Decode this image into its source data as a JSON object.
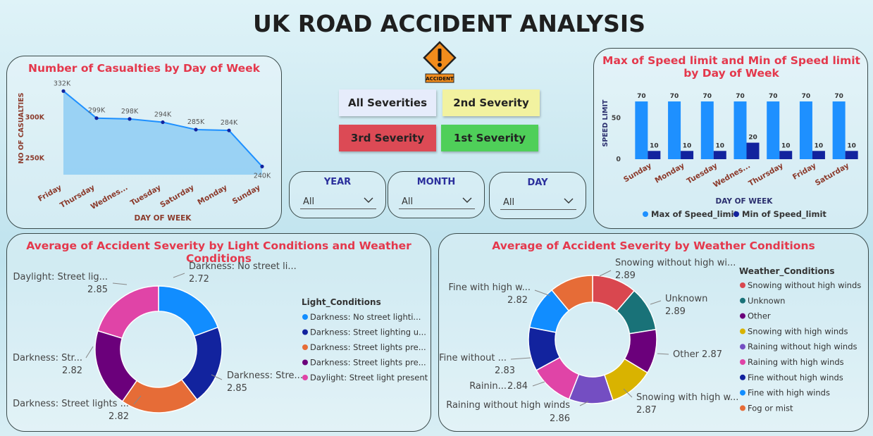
{
  "title": "UK ROAD ACCIDENT ANALYSIS",
  "logo_label": "ACCIDENT",
  "buttons": {
    "all": "All Severities",
    "second": "2nd Severity",
    "third": "3rd Severity",
    "first": "1st Severity"
  },
  "colors": {
    "title_red": "#e4384c",
    "btn_all": "#e6ecfb",
    "btn_second": "#f2f2a0",
    "btn_third": "#dc4a55",
    "btn_first": "#4fcf59",
    "line_fill": "#8ecdf3",
    "line_stroke": "#1e90ff",
    "bar_max": "#1e90ff",
    "bar_min": "#12239e"
  },
  "slicers": [
    {
      "label": "YEAR",
      "value": "All"
    },
    {
      "label": "MONTH",
      "value": "All"
    },
    {
      "label": "DAY",
      "value": "All"
    }
  ],
  "chart_data": [
    {
      "id": "casualties",
      "type": "area",
      "title": "Number of Casualties by Day of Week",
      "xlabel": "DAY OF WEEK",
      "ylabel": "NO OF CASUALTIES",
      "categories": [
        "Friday",
        "Thursday",
        "Wednes...",
        "Tuesday",
        "Saturday",
        "Monday",
        "Sunday"
      ],
      "values": [
        332000,
        299000,
        298000,
        294000,
        285000,
        284000,
        240000
      ],
      "data_labels": [
        "332K",
        "299K",
        "298K",
        "294K",
        "285K",
        "284K",
        "240K"
      ],
      "yticks": [
        250000,
        300000
      ],
      "ytick_labels": [
        "250K",
        "300K"
      ],
      "ylim": [
        230000,
        340000
      ]
    },
    {
      "id": "speed",
      "type": "bar",
      "title": "Max of Speed limit and Min of Speed limit by Day of Week",
      "xlabel": "DAY OF WEEK",
      "ylabel": "SPEED LIMIT",
      "categories": [
        "Sunday",
        "Monday",
        "Tuesday",
        "Wednes...",
        "Thursday",
        "Friday",
        "Saturday"
      ],
      "series": [
        {
          "name": "Max of Speed_limit",
          "values": [
            70,
            70,
            70,
            70,
            70,
            70,
            70
          ]
        },
        {
          "name": "Min of Speed_limit",
          "values": [
            10,
            10,
            10,
            20,
            10,
            10,
            10
          ]
        }
      ],
      "yticks": [
        0,
        50
      ],
      "ylim": [
        0,
        76
      ],
      "legend": "bottom"
    },
    {
      "id": "light",
      "type": "pie",
      "title": "Average of Accident Severity by Light Conditions and Weather Conditions",
      "legend_title": "Light_Conditions",
      "slices": [
        {
          "label": "Darkness: No street li...",
          "legend": "Darkness: No street lighti...",
          "value": 2.72,
          "color": "#118dff"
        },
        {
          "label": "Darkness: Stre...",
          "legend": "Darkness: Street lighting u...",
          "value": 2.85,
          "color": "#12239e"
        },
        {
          "label": "Darkness: Street lights ...",
          "legend": "Darkness: Street lights pre...",
          "value": 2.82,
          "color": "#e66c37"
        },
        {
          "label": "Darkness: Str...",
          "legend": "Darkness: Street lights pre...",
          "value": 2.82,
          "color": "#6b007b"
        },
        {
          "label": "Daylight: Street lig...",
          "legend": "Daylight: Street light present",
          "value": 2.85,
          "color": "#e044a7"
        }
      ]
    },
    {
      "id": "weather",
      "type": "pie",
      "title": "Average of Accident Severity by Weather Conditions",
      "legend_title": "Weather_Conditions",
      "slices": [
        {
          "label": "Snowing without high wi...",
          "legend": "Snowing without high winds",
          "value": 2.89,
          "color": "#d9474f"
        },
        {
          "label": "Unknown",
          "legend": "Unknown",
          "value": 2.89,
          "color": "#197278"
        },
        {
          "label": "Other 2.87",
          "legend": "Other",
          "value": 2.87,
          "color": "#6b007b"
        },
        {
          "label": "Snowing with high w...",
          "legend": "Snowing with high winds",
          "value": 2.87,
          "color": "#d9b300"
        },
        {
          "label": "Raining without high winds",
          "legend": "Raining without high winds",
          "value": 2.86,
          "color": "#744ec2"
        },
        {
          "label": "Rainin...",
          "legend": "Raining with high winds",
          "value": 2.84,
          "color": "#e044a7"
        },
        {
          "label": "Fine without ...",
          "legend": "Fine without high winds",
          "value": 2.83,
          "color": "#12239e"
        },
        {
          "label": "Fine with high w...",
          "legend": "Fine with high winds",
          "value": 2.82,
          "color": "#118dff"
        },
        {
          "label": "",
          "legend": "Fog or mist",
          "value": 2.82,
          "color": "#e66c37"
        }
      ]
    }
  ]
}
